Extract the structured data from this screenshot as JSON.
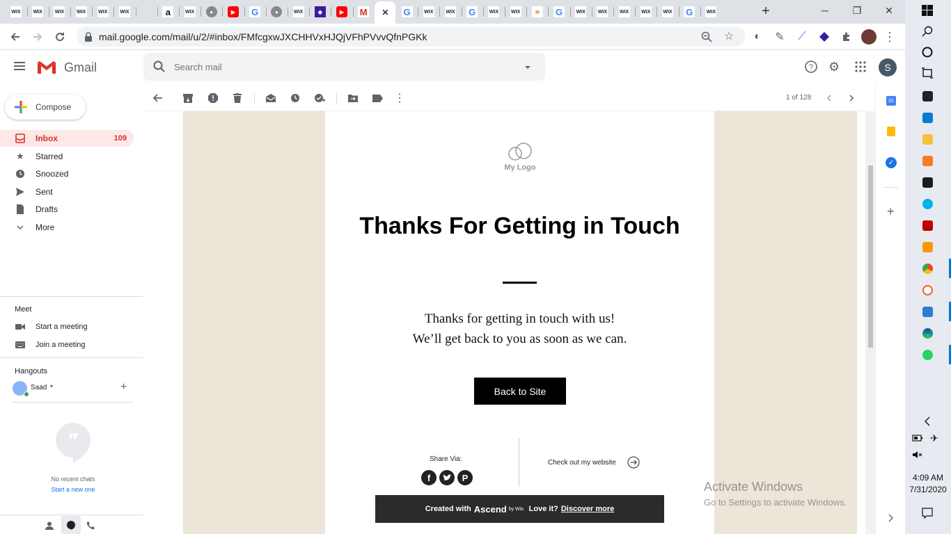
{
  "browser": {
    "tabs": [
      "wix",
      "wix",
      "wix",
      "wix",
      "wix",
      "wix",
      "",
      "amazon",
      "wix",
      "web",
      "youtube",
      "google",
      "web",
      "wix",
      "purple",
      "youtube",
      "gmail",
      "close",
      "google",
      "wix",
      "wix",
      "google",
      "wix",
      "wix",
      "stack",
      "google",
      "wix",
      "wix",
      "wix",
      "wix",
      "wix",
      "google",
      "wix"
    ],
    "tab_wix_label": "WIX",
    "url": "mail.google.com/mail/u/2/#inbox/FMfcgxwJXCHHVxHJQjVFhPVvvQfnPGKk",
    "new_tab": "+",
    "win_min": "─",
    "win_max": "❐",
    "win_close": "✕"
  },
  "gmail": {
    "app_name": "Gmail",
    "search_placeholder": "Search mail",
    "avatar_letter": "S",
    "compose_label": "Compose",
    "nav": [
      {
        "label": "Inbox",
        "count": "109"
      },
      {
        "label": "Starred"
      },
      {
        "label": "Snoozed"
      },
      {
        "label": "Sent"
      },
      {
        "label": "Drafts"
      },
      {
        "label": "More"
      }
    ],
    "meet_title": "Meet",
    "meet_items": [
      "Start a meeting",
      "Join a meeting"
    ],
    "hangouts_title": "Hangouts",
    "hangouts_user": "Saad",
    "no_chats": "No recent chats",
    "start_new": "Start a new one",
    "pagination": "1 of 128"
  },
  "email": {
    "logo_text": "My Logo",
    "headline": "Thanks For Getting in Touch",
    "line1": "Thanks for getting in touch with us!",
    "line2": "We’ll get back to you as soon as we can.",
    "cta": "Back to Site",
    "share_via": "Share Via:",
    "check_out": "Check out my website",
    "footer_created": "Created with",
    "footer_brand": "Ascend",
    "footer_by": "by Wix.",
    "footer_love": "Love it?",
    "footer_link": "Discover more"
  },
  "watermark": {
    "line1": "Activate Windows",
    "line2": "Go to Settings to activate Windows."
  },
  "taskbar": {
    "time": "4:09 AM",
    "date": "7/31/2020"
  },
  "colors": {
    "gmail_red": "#d93025",
    "email_bg": "#ede5d8",
    "button_black": "#000000",
    "footer_dark": "#2b2b2b"
  }
}
